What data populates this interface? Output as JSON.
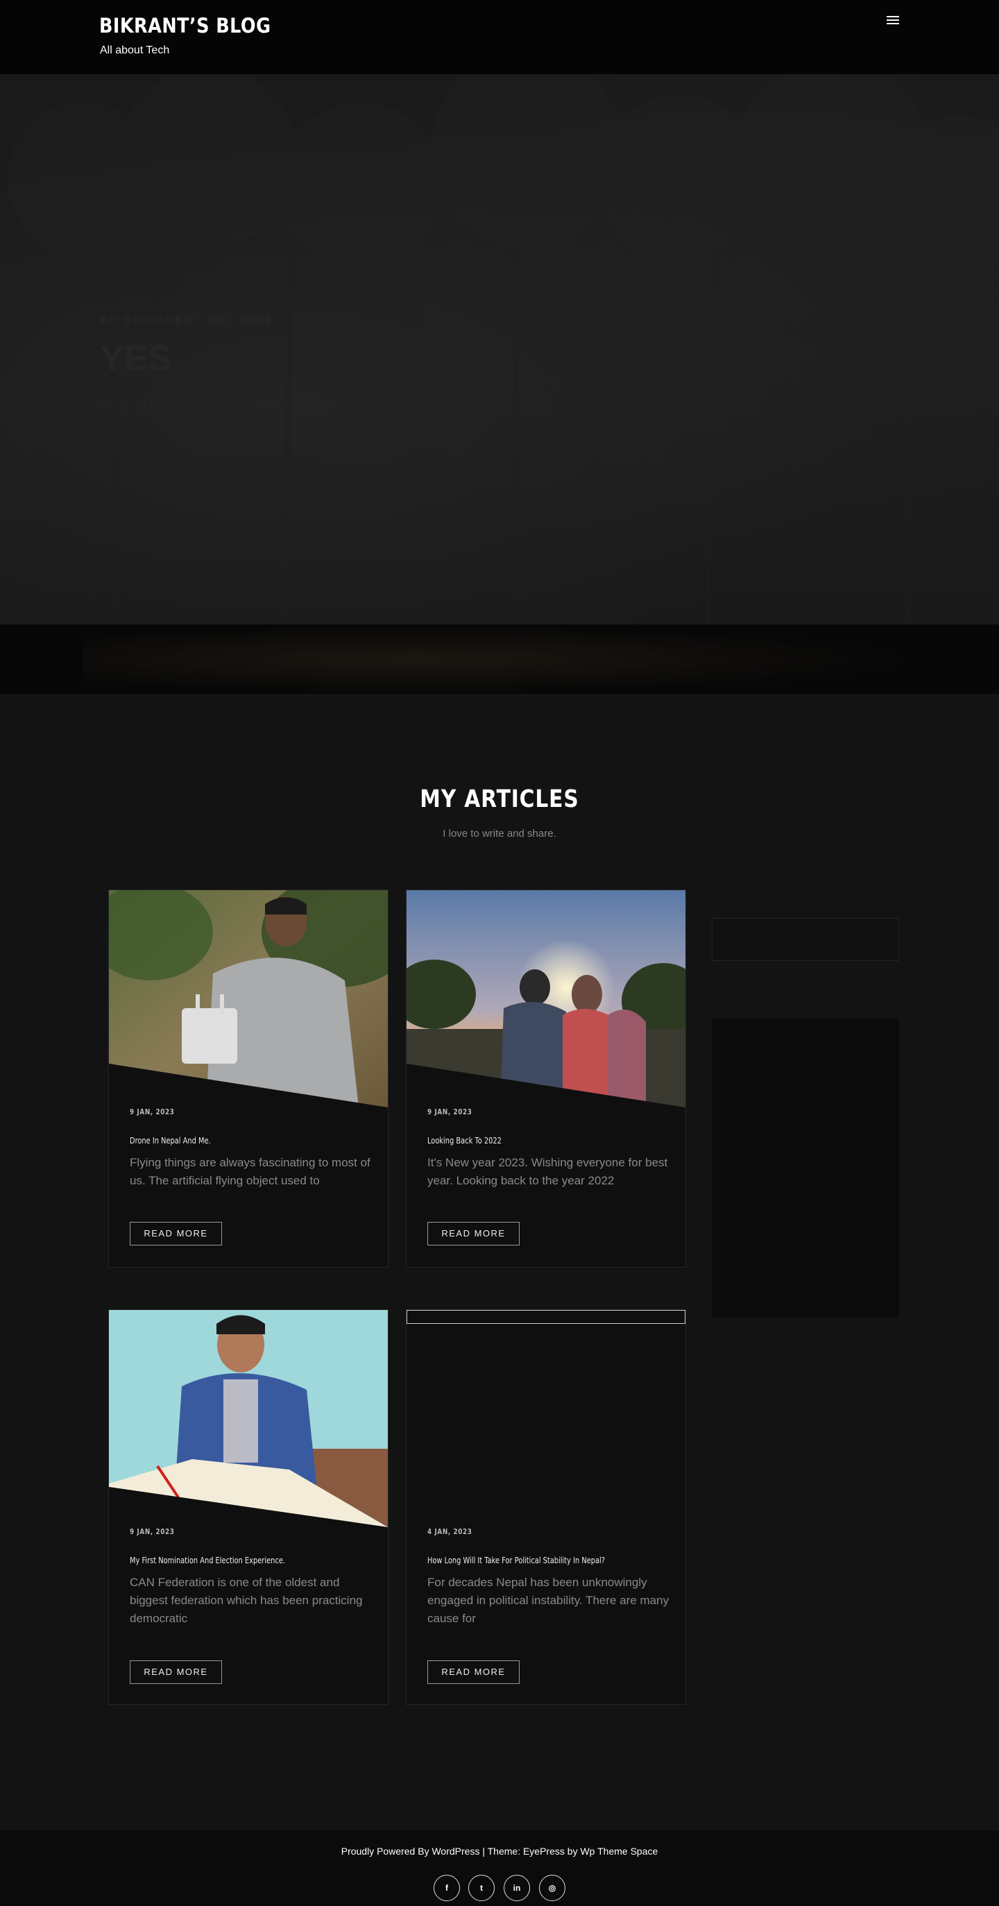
{
  "header": {
    "site_title": "BIKRANT’S BLOG",
    "tagline": "All about Tech",
    "menu_icon": "hamburger-menu-icon"
  },
  "hero": {
    "small_text": "Be Different Act Wise",
    "big_text": "YES",
    "sub_text": "It's Time to Think Different"
  },
  "articles_section": {
    "title": "MY ARTICLES",
    "subtitle": "I love to write and share."
  },
  "articles": [
    {
      "date": "9 JAN, 2023",
      "title": "Drone In Nepal And Me.",
      "excerpt": "Flying things are always fascinating to most of us. The artificial flying object used to",
      "button": "READ MORE"
    },
    {
      "date": "9 JAN, 2023",
      "title": "Looking Back To 2022",
      "excerpt": "It's New year 2023. Wishing everyone for best year. Looking back to the year 2022",
      "button": "READ MORE"
    },
    {
      "date": "9 JAN, 2023",
      "title": "My First Nomination And Election Experience.",
      "excerpt": "CAN Federation is one of the oldest and biggest federation which has been practicing democratic",
      "button": "READ MORE"
    },
    {
      "date": "4 JAN, 2023",
      "title": "How Long Will It Take For Political Stability In Nepal?",
      "excerpt": "For decades Nepal has been unknowingly engaged in political instability. There are many cause for",
      "button": "READ MORE"
    }
  ],
  "footer": {
    "powered_prefix": "Proudly Powered By ",
    "wordpress": "WordPress",
    "separator": " | Theme: ",
    "theme": "EyePress",
    "by": " by ",
    "author": "Wp Theme Space",
    "social": [
      {
        "icon": "facebook-icon",
        "glyph": "f"
      },
      {
        "icon": "twitter-icon",
        "glyph": "t"
      },
      {
        "icon": "linkedin-icon",
        "glyph": "in"
      },
      {
        "icon": "instagram-icon",
        "glyph": "◎"
      }
    ]
  }
}
